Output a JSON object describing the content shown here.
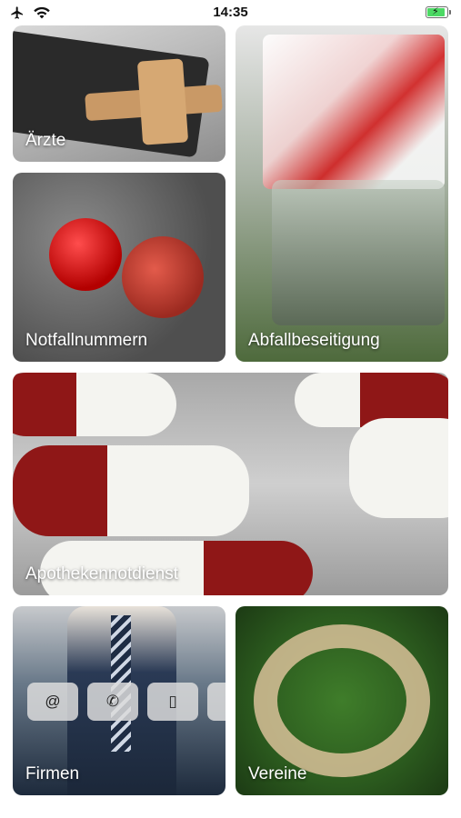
{
  "status_bar": {
    "time": "14:35",
    "airplane_icon": "airplane-icon",
    "wifi_icon": "wifi-icon",
    "battery_icon": "battery-charging-icon"
  },
  "tiles": [
    {
      "label": "Ärzte"
    },
    {
      "label": "Notfallnummern"
    },
    {
      "label": "Abfallbeseitigung"
    },
    {
      "label": "Apothekennotdienst"
    },
    {
      "label": "Firmen"
    },
    {
      "label": "Vereine"
    }
  ],
  "firmen_contact_icons": {
    "email": "@",
    "phone": "✆",
    "mobile": "▯",
    "mail": "✉"
  },
  "colors": {
    "battery_green": "#4cd964",
    "label_text": "#ffffff"
  }
}
